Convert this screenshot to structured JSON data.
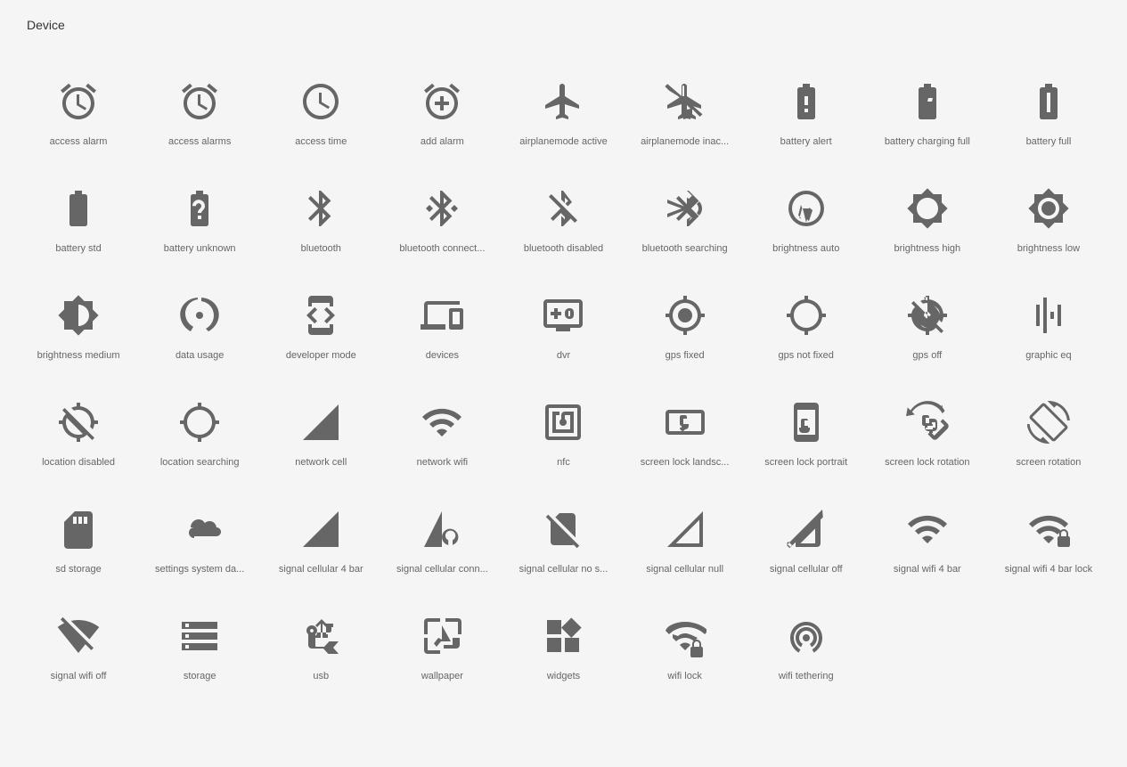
{
  "page": {
    "title": "Device"
  },
  "icons": [
    {
      "name": "access-alarm",
      "label": "access alarm"
    },
    {
      "name": "access-alarms",
      "label": "access alarms"
    },
    {
      "name": "access-time",
      "label": "access time"
    },
    {
      "name": "add-alarm",
      "label": "add alarm"
    },
    {
      "name": "airplanemode-active",
      "label": "airplanemode active"
    },
    {
      "name": "airplanemode-inactive",
      "label": "airplanemode inac..."
    },
    {
      "name": "battery-alert",
      "label": "battery alert"
    },
    {
      "name": "battery-charging-full",
      "label": "battery charging full"
    },
    {
      "name": "battery-full",
      "label": "battery full"
    },
    {
      "name": "battery-std",
      "label": "battery std"
    },
    {
      "name": "battery-unknown",
      "label": "battery unknown"
    },
    {
      "name": "bluetooth",
      "label": "bluetooth"
    },
    {
      "name": "bluetooth-connected",
      "label": "bluetooth connect..."
    },
    {
      "name": "bluetooth-disabled",
      "label": "bluetooth disabled"
    },
    {
      "name": "bluetooth-searching",
      "label": "bluetooth searching"
    },
    {
      "name": "brightness-auto",
      "label": "brightness auto"
    },
    {
      "name": "brightness-high",
      "label": "brightness high"
    },
    {
      "name": "brightness-low",
      "label": "brightness low"
    },
    {
      "name": "brightness-medium",
      "label": "brightness medium"
    },
    {
      "name": "data-usage",
      "label": "data usage"
    },
    {
      "name": "developer-mode",
      "label": "developer mode"
    },
    {
      "name": "devices",
      "label": "devices"
    },
    {
      "name": "dvr",
      "label": "dvr"
    },
    {
      "name": "gps-fixed",
      "label": "gps fixed"
    },
    {
      "name": "gps-not-fixed",
      "label": "gps not fixed"
    },
    {
      "name": "gps-off",
      "label": "gps off"
    },
    {
      "name": "graphic-eq",
      "label": "graphic eq"
    },
    {
      "name": "location-disabled",
      "label": "location disabled"
    },
    {
      "name": "location-searching",
      "label": "location searching"
    },
    {
      "name": "network-cell",
      "label": "network cell"
    },
    {
      "name": "network-wifi",
      "label": "network wifi"
    },
    {
      "name": "nfc",
      "label": "nfc"
    },
    {
      "name": "screen-lock-landscape",
      "label": "screen lock landsc..."
    },
    {
      "name": "screen-lock-portrait",
      "label": "screen lock portrait"
    },
    {
      "name": "screen-lock-rotation",
      "label": "screen lock rotation"
    },
    {
      "name": "screen-rotation",
      "label": "screen rotation"
    },
    {
      "name": "sd-storage",
      "label": "sd storage"
    },
    {
      "name": "settings-system-daydream",
      "label": "settings system da..."
    },
    {
      "name": "signal-cellular-4bar",
      "label": "signal cellular 4 bar"
    },
    {
      "name": "signal-cellular-connected",
      "label": "signal cellular conn..."
    },
    {
      "name": "signal-cellular-no-sim",
      "label": "signal cellular no s..."
    },
    {
      "name": "signal-cellular-null",
      "label": "signal cellular null"
    },
    {
      "name": "signal-cellular-off",
      "label": "signal cellular off"
    },
    {
      "name": "signal-wifi-4bar",
      "label": "signal wifi 4 bar"
    },
    {
      "name": "signal-wifi-4bar-lock",
      "label": "signal wifi 4 bar lock"
    },
    {
      "name": "signal-wifi-off",
      "label": "signal wifi off"
    },
    {
      "name": "storage",
      "label": "storage"
    },
    {
      "name": "usb",
      "label": "usb"
    },
    {
      "name": "wallpaper",
      "label": "wallpaper"
    },
    {
      "name": "widgets",
      "label": "widgets"
    },
    {
      "name": "wifi-lock",
      "label": "wifi lock"
    },
    {
      "name": "wifi-tethering",
      "label": "wifi tethering"
    }
  ]
}
